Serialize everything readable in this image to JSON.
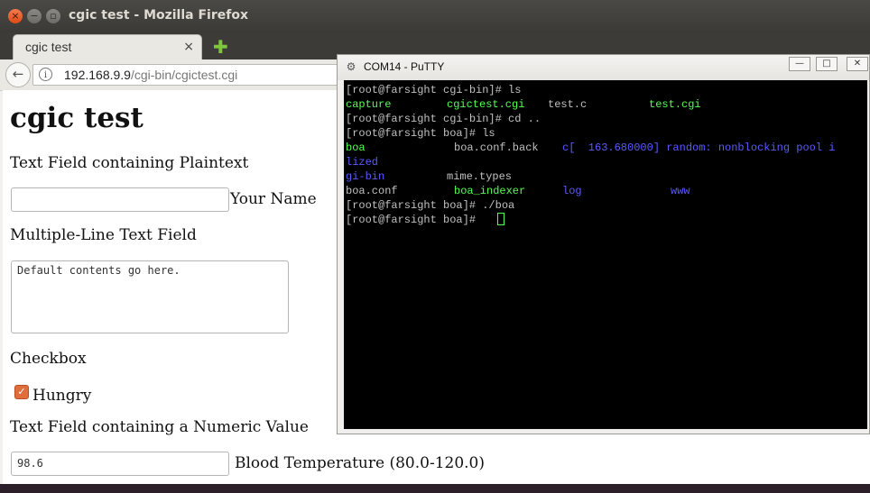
{
  "firefox": {
    "window_title": "cgic test - Mozilla Firefox",
    "win_close": "×",
    "win_min": "−",
    "win_max": "▫",
    "tab_label": "cgic test",
    "tab_close": "×",
    "new_tab": "✚",
    "back_glyph": "←",
    "info_glyph": "i",
    "url_host": "192.168.9.9",
    "url_path": "/cgi-bin/cgictest.cgi"
  },
  "page": {
    "title": "cgic test",
    "plaintext_heading": "Text Field containing Plaintext",
    "name_value": "",
    "name_label": "Your Name",
    "multiline_heading": "Multiple-Line Text Field",
    "multiline_value": "Default contents go here.",
    "checkbox_heading": "Checkbox",
    "hungry_checked": true,
    "hungry_glyph": "✓",
    "hungry_label": "Hungry",
    "numeric_heading": "Text Field containing a Numeric Value",
    "temperature_value": "98.6",
    "temperature_label": "Blood Temperature (80.0-120.0)"
  },
  "putty": {
    "icon_glyph": "⚙",
    "title": "COM14 - PuTTY",
    "btn_min": "—",
    "btn_max": "□",
    "btn_close": "✕",
    "lines": {
      "l1": "[root@farsight cgi-bin]# ls",
      "l2a": "capture",
      "l2b": "cgictest.cgi",
      "l2c": "test.c",
      "l2d": "test.cgi",
      "l3": "[root@farsight cgi-bin]# cd ..",
      "l4": "[root@farsight boa]# ls",
      "l5a": "boa",
      "l5b": "boa.conf.back",
      "l5c": "c[  163.680000] random: nonblocking pool i",
      "l6": "lized",
      "l7a": "gi-bin",
      "l7b": "mime.types",
      "l8a": "boa.conf",
      "l8b": "boa_indexer",
      "l8c": "log",
      "l8d": "www",
      "l9": "[root@farsight boa]# ./boa",
      "l10": "[root@farsight boa]# "
    }
  },
  "colors": {
    "terminal_green": "#54ff54",
    "terminal_blue": "#5a5aff",
    "checkbox_accent": "#e06d3c"
  }
}
